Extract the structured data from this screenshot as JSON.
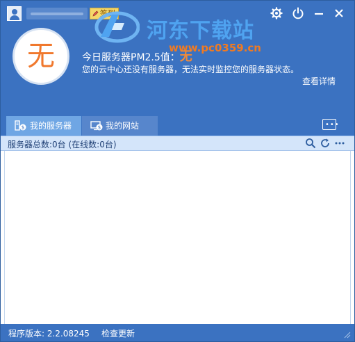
{
  "header": {
    "checkin_label": "签到",
    "watermark": {
      "title": "河东下载站",
      "url": "www.pc0359.cn"
    },
    "pm": {
      "circle_value": "无",
      "title_prefix": "今日服务器PM2.5值：",
      "title_value": "无",
      "description": "您的云中心还没有服务器，无法实时监控您的服务器状态。",
      "details_link": "查看详情"
    }
  },
  "tabs": [
    {
      "label": "我的服务器",
      "icon": "server-icon",
      "active": true
    },
    {
      "label": "我的网站",
      "icon": "website-icon",
      "active": false
    }
  ],
  "toolbar": {
    "server_count": "服务器总数:0台 (在线数:0台)"
  },
  "statusbar": {
    "version": "程序版本: 2.2.08245",
    "check_update": "检查更新"
  },
  "colors": {
    "header_bg": "#3b72c1",
    "active_tab": "#6fa6e4",
    "accent_orange": "#f0782d",
    "toolbar_bg": "#d4e5fa"
  }
}
